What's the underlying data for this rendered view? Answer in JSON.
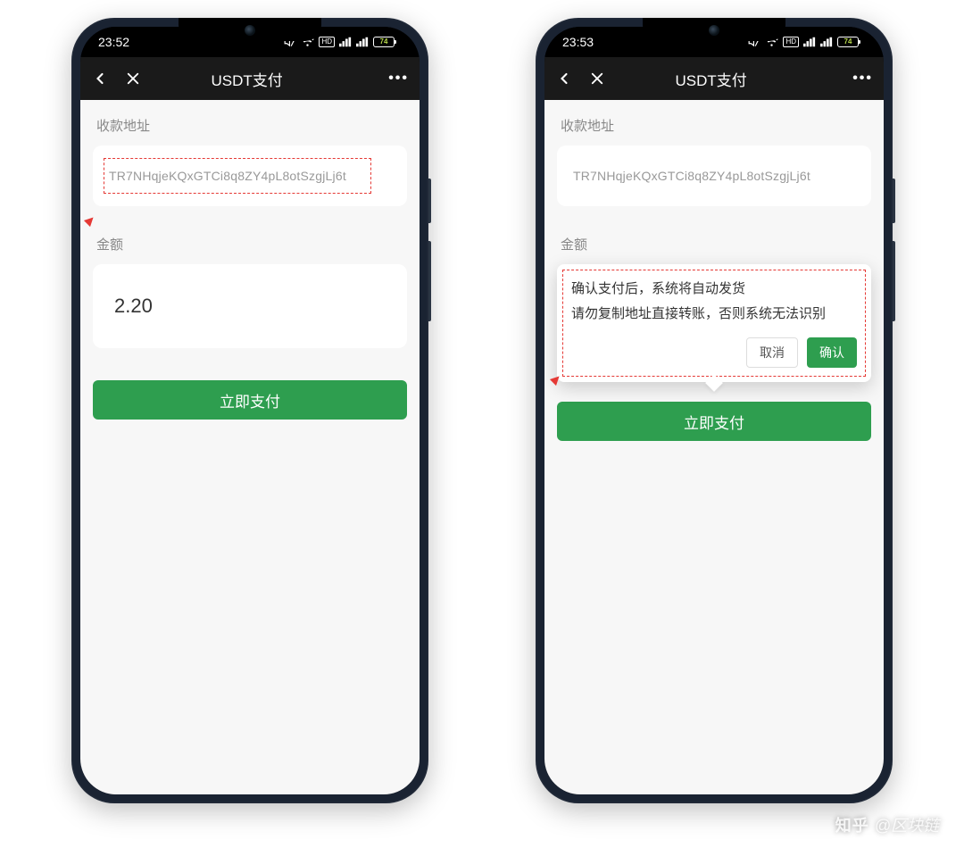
{
  "left": {
    "status": {
      "time": "23:52",
      "battery": "74"
    },
    "nav": {
      "title": "USDT支付"
    },
    "section_address_label": "收款地址",
    "address": "TR7NHqjeKQxGTCi8q8ZY4pL8otSzgjLj6t",
    "section_amount_label": "金额",
    "amount": "2.20",
    "pay_button": "立即支付"
  },
  "right": {
    "status": {
      "time": "23:53",
      "battery": "74"
    },
    "nav": {
      "title": "USDT支付"
    },
    "section_address_label": "收款地址",
    "address": "TR7NHqjeKQxGTCi8q8ZY4pL8otSzgjLj6t",
    "section_amount_label": "金额",
    "popover": {
      "line1": "确认支付后，系统将自动发货",
      "line2": "请勿复制地址直接转账，否则系统无法识别",
      "cancel": "取消",
      "confirm": "确认"
    },
    "pay_button": "立即支付"
  },
  "watermark": {
    "brand": "知乎",
    "author": "@区块链"
  }
}
